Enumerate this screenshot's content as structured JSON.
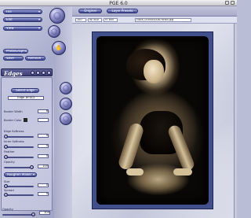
{
  "window": {
    "title": "PGE 6.0"
  },
  "left": {
    "menu_pills": [
      {
        "label": "File"
      },
      {
        "label": "Edit"
      },
      {
        "label": "View"
      }
    ],
    "lower_pills": [
      {
        "label": "PhotoGraphic"
      },
      {
        "label": "Save"
      },
      {
        "label": "Remove"
      }
    ],
    "edges": {
      "title": "Edges",
      "select_btn": "Select Edge",
      "edge_name": "Edge #FD02",
      "params": [
        {
          "label": "Border Width",
          "value": "6"
        },
        {
          "label": "Border Color",
          "value": ""
        },
        {
          "label": "Edge Softness",
          "value": "0"
        },
        {
          "label": "Inner Softness",
          "value": "0"
        },
        {
          "label": "Feather",
          "value": "0"
        },
        {
          "label": "Opacity",
          "value": "100"
        }
      ],
      "effect_btn": "Roughen Maker",
      "effect_params": [
        {
          "label": "Size",
          "value": "0"
        },
        {
          "label": "Spread",
          "value": "0"
        }
      ],
      "bottom_label": "Opacity",
      "bottom_value": "100"
    }
  },
  "toolbar": {
    "original_btn": "Original",
    "presets_btn": "Layer Presets"
  },
  "infobar": {
    "cells": [
      "100",
      "W: 800",
      "H: 800",
      "clock_00000000874Holl.jpg"
    ]
  },
  "colors": {
    "accent": "#4a4f92",
    "frame": "#41508a"
  }
}
